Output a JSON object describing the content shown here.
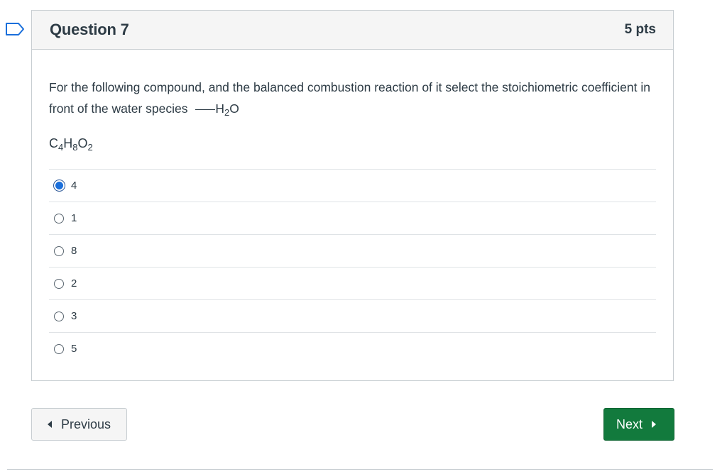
{
  "question": {
    "title": "Question 7",
    "points": "5 pts",
    "text": "For the following compound, and the balanced combustion reaction of it select the stoichiometric coefficient in front of the water species",
    "water_species": {
      "H": "H",
      "sub2": "2",
      "O": "O"
    },
    "compound": {
      "C": "C",
      "c_sub": "4",
      "H": "H",
      "h_sub": "8",
      "O": "O",
      "o_sub": "2"
    },
    "answers": [
      {
        "label": "4",
        "selected": true
      },
      {
        "label": "1",
        "selected": false
      },
      {
        "label": "8",
        "selected": false
      },
      {
        "label": "2",
        "selected": false
      },
      {
        "label": "3",
        "selected": false
      },
      {
        "label": "5",
        "selected": false
      }
    ]
  },
  "nav": {
    "previous_label": "Previous",
    "next_label": "Next"
  },
  "icons": {
    "flag": "bookmark-flag-icon",
    "prev": "triangle-left-icon",
    "next": "triangle-right-icon"
  },
  "colors": {
    "accent_blue": "#1a6fdb",
    "next_button": "#127a3d",
    "text": "#2d3b45",
    "header_bg": "#f5f5f5"
  }
}
